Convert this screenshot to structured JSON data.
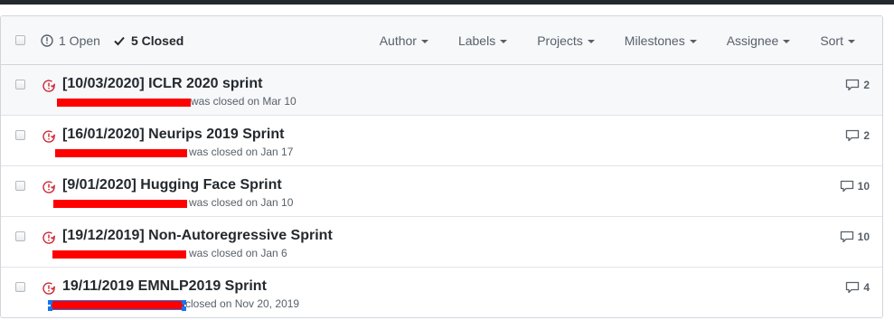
{
  "header": {
    "open_label": "1 Open",
    "closed_label": "5 Closed",
    "filters": [
      "Author",
      "Labels",
      "Projects",
      "Milestones",
      "Assignee",
      "Sort"
    ]
  },
  "issues": [
    {
      "title": "[10/03/2020] ICLR 2020 sprint",
      "meta": "was closed on Mar 10",
      "comments": "2"
    },
    {
      "title": "[16/01/2020] Neurips 2019 Sprint",
      "meta": "was closed on Jan 17",
      "comments": "2"
    },
    {
      "title": "[9/01/2020] Hugging Face Sprint",
      "meta": "was closed on Jan 10",
      "comments": "10"
    },
    {
      "title": "[19/12/2019] Non-Autoregressive Sprint",
      "meta": "was closed on Jan 6",
      "comments": "10"
    },
    {
      "title": "19/11/2019 EMNLP2019 Sprint",
      "meta": "closed on Nov 20, 2019",
      "comments": "4"
    }
  ],
  "colors": {
    "closed_icon": "#cb2431",
    "redaction": "#ff0000",
    "selection": "#1a73e8"
  },
  "icons": {
    "open": "issue-opened-icon",
    "closed": "check-icon",
    "issue": "issue-closed-icon",
    "comment": "comment-icon"
  }
}
